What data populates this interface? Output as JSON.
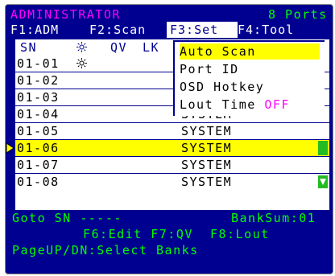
{
  "header": {
    "title": "ADMINISTRATOR",
    "ports": "8 Ports"
  },
  "menu": {
    "f1": "F1:ADM",
    "f2": "F2:Scan",
    "f3": "F3:Set",
    "f4": "F4:Tool"
  },
  "table": {
    "headers": {
      "sn": "SN",
      "qv": "QV",
      "lk": "LK"
    },
    "rows": [
      {
        "sn": "01-01",
        "name": "",
        "sun_icon": true,
        "selected": false
      },
      {
        "sn": "01-02",
        "name": "",
        "sun_icon": false,
        "selected": false
      },
      {
        "sn": "01-03",
        "name": "",
        "sun_icon": false,
        "selected": false
      },
      {
        "sn": "01-04",
        "name": "SYSTEM",
        "sun_icon": false,
        "selected": false
      },
      {
        "sn": "01-05",
        "name": "SYSTEM",
        "sun_icon": false,
        "selected": false
      },
      {
        "sn": "01-06",
        "name": "SYSTEM",
        "sun_icon": false,
        "selected": true
      },
      {
        "sn": "01-07",
        "name": "SYSTEM",
        "sun_icon": false,
        "selected": false
      },
      {
        "sn": "01-08",
        "name": "SYSTEM",
        "sun_icon": false,
        "selected": false
      }
    ]
  },
  "set_menu": {
    "items": [
      "Auto Scan",
      "Port ID",
      "OSD Hotkey",
      "Lout Time "
    ],
    "lout_state": "OFF"
  },
  "footer": {
    "goto": "Goto SN -----",
    "banksum": "BankSum:01",
    "hotkeys": "F6:Edit F7:QV  F8:Lout",
    "pageupdn": "PageUP/DN:Select Banks"
  },
  "colors": {
    "background": "#000090",
    "list_bg": "#ffffff",
    "highlight": "#ffff00",
    "accent_green": "#00ff00",
    "accent_magenta": "#ff00ff"
  }
}
